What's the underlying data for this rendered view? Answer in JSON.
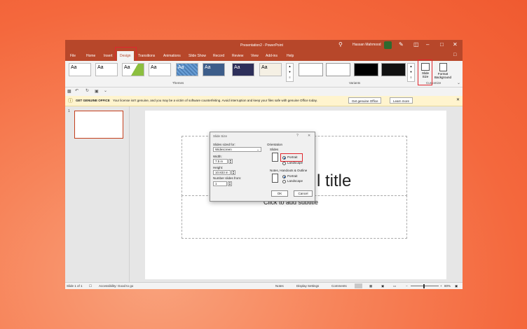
{
  "window": {
    "title": "Presentation2 - PowerPoint",
    "user": "Hassan Mahmood"
  },
  "tabs": [
    "File",
    "Home",
    "Insert",
    "Design",
    "Transitions",
    "Animations",
    "Slide Show",
    "Record",
    "Review",
    "View",
    "Add-ins",
    "Help"
  ],
  "ribbon": {
    "themes_label": "Themes",
    "variants_label": "Variants",
    "customize_label": "Customize",
    "theme_sample": "Aa",
    "slide_size_label": "Slide Size",
    "format_background_label": "Format Background"
  },
  "infobar": {
    "heading": "GET GENUINE OFFICE",
    "message": "Your license isn't genuine, and you may be a victim of software counterfeiting. Avoid interruption and keep your files safe with genuine Office today.",
    "btn_genuine": "Get genuine Office",
    "btn_learn": "Learn more"
  },
  "thumb_number": "1",
  "slide": {
    "title_visible": "l title",
    "subtitle": "Click to add subtitle"
  },
  "dialog": {
    "title": "Slide Size",
    "sized_for_label": "Slides sized for:",
    "sized_for_value": "Widescreen",
    "width_label": "Width:",
    "width_value": "7.5 in",
    "height_label": "Height:",
    "height_value": "10.833 in",
    "number_from_label": "Number slides from:",
    "number_from_value": "1",
    "orientation_label": "Orientation",
    "slides_label": "Slides",
    "portrait": "Portrait",
    "landscape": "Landscape",
    "notes_label": "Notes, Handouts & Outline",
    "ok": "OK",
    "cancel": "Cancel"
  },
  "statusbar": {
    "slide_of": "Slide 1 of 1",
    "accessibility": "Accessibility: Good to go",
    "notes": "Notes",
    "display_settings": "Display Settings",
    "comments": "Comments",
    "zoom": "80%"
  },
  "colors": {
    "accent": "#b7472a",
    "highlight": "#e0262d"
  }
}
